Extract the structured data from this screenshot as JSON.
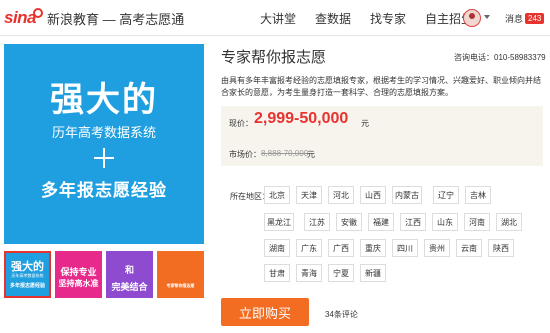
{
  "header": {
    "logo_brand": "sina",
    "logo_text": "新浪教育 — 高考志愿通",
    "nav": [
      "大讲堂",
      "查数据",
      "找专家",
      "自主招生"
    ],
    "message_label": "消息",
    "message_count": "243"
  },
  "banner": {
    "line1": "强大的",
    "line2": "历年高考数据系统",
    "line3": "多年报志愿经验"
  },
  "thumbs": [
    {
      "l1": "强大的",
      "l2": "历年高考数据系统",
      "l3": "多年报志愿经验"
    },
    {
      "l1": "保持专业",
      "l2": "坚持高水准"
    },
    {
      "l1": "和",
      "l2": "完美结合"
    },
    {
      "l1": "专家帮你报志愿"
    }
  ],
  "product": {
    "title": "专家帮你报志愿",
    "phone": "咨询电话：010-58983379",
    "description": "由具有多年丰富报考经验的志愿填报专家，根据考生的学习情况、兴趣爱好、职业倾向并结合家长的意愿，为考生量身打造一套科学、合理的志愿填报方案。",
    "price_label": "现价：",
    "price": "2,999-50,000",
    "price_unit": "元",
    "market_label": "市场价：",
    "market_price": "8,888-70,000",
    "market_unit": "元",
    "region_label": "所在地区：",
    "regions": [
      [
        "北京",
        "天津",
        "河北",
        "山西",
        "内蒙古",
        "辽宁",
        "吉林"
      ],
      [
        "黑龙江",
        "江苏",
        "安徽",
        "福建",
        "江西",
        "山东",
        "河南",
        "湖北"
      ],
      [
        "湖南",
        "广东",
        "广西",
        "重庆",
        "四川",
        "贵州",
        "云南",
        "陕西"
      ],
      [
        "甘肃",
        "青海",
        "宁夏",
        "新疆"
      ]
    ],
    "buy_label": "立即购买",
    "comments": "34条评论"
  },
  "colors": {
    "accent_red": "#e8322e",
    "banner_blue": "#1f9fe0",
    "buy_orange": "#f26c22",
    "price_bg": "#f7f4ee"
  }
}
